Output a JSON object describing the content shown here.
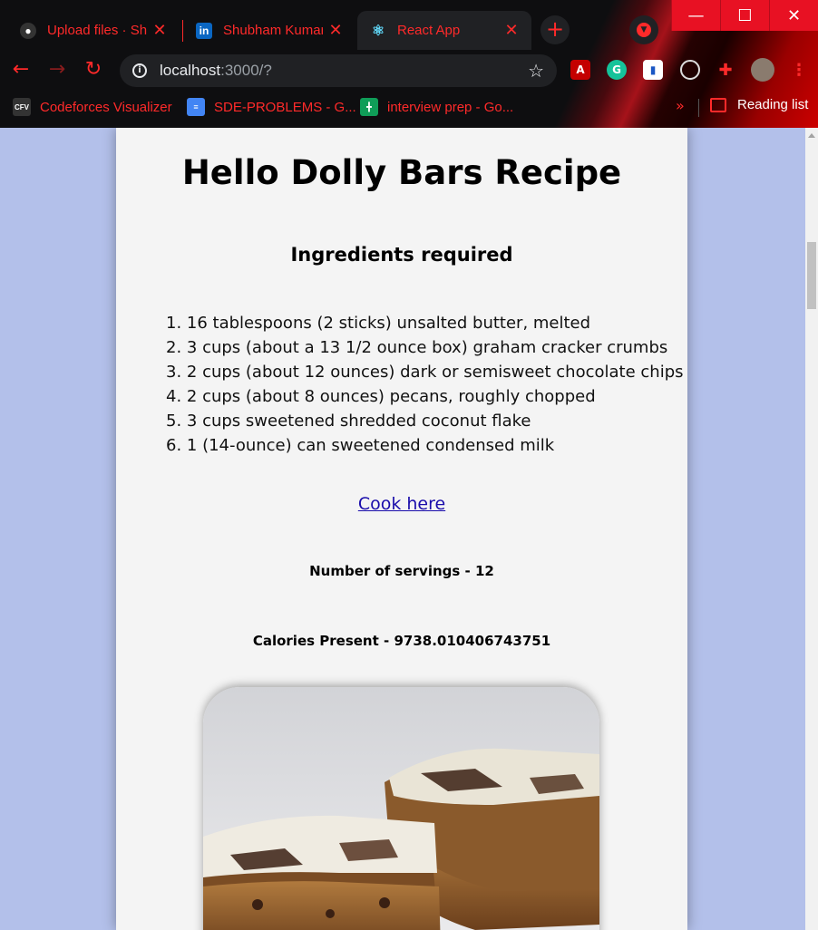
{
  "browser": {
    "tabs": [
      {
        "title": "Upload files · Shu",
        "icon": "github-icon"
      },
      {
        "title": "Shubham Kumar",
        "icon": "linkedin-icon"
      },
      {
        "title": "React App",
        "icon": "react-icon"
      }
    ],
    "new_tab": "+",
    "window": {
      "minimize": "—",
      "maximize": "☐",
      "close": "✕"
    },
    "url_host": "localhost",
    "url_path": ":3000/?",
    "bookmarks": [
      {
        "label": "Codeforces Visualizer",
        "icon": "CFV"
      },
      {
        "label": "SDE-PROBLEMS - G...",
        "icon": "docs-icon"
      },
      {
        "label": "interview prep - Go...",
        "icon": "sheets-icon"
      }
    ],
    "more_bookmarks": "»",
    "reading_list": "Reading list"
  },
  "recipe": {
    "title": "Hello Dolly Bars Recipe",
    "ingredients_heading": "Ingredients required",
    "ingredients": [
      "1. 16 tablespoons (2 sticks) unsalted butter, melted",
      "2. 3 cups (about a 13 1/2 ounce box) graham cracker crumbs",
      "3. 2 cups (about 12 ounces) dark or semisweet chocolate chips",
      "4. 2 cups (about 8 ounces) pecans, roughly chopped",
      "5. 3 cups sweetened shredded coconut flake",
      "6. 1 (14-ounce) can sweetened condensed milk"
    ],
    "cook_link": "Cook here",
    "servings": "Number of servings - 12",
    "calories": "Calories Present - 9738.010406743751"
  },
  "colors": {
    "page_background": "#b3c0ea",
    "card_background": "#f4f4f4",
    "link": "#1a0dab",
    "theme_red": "#ff2a2a"
  }
}
